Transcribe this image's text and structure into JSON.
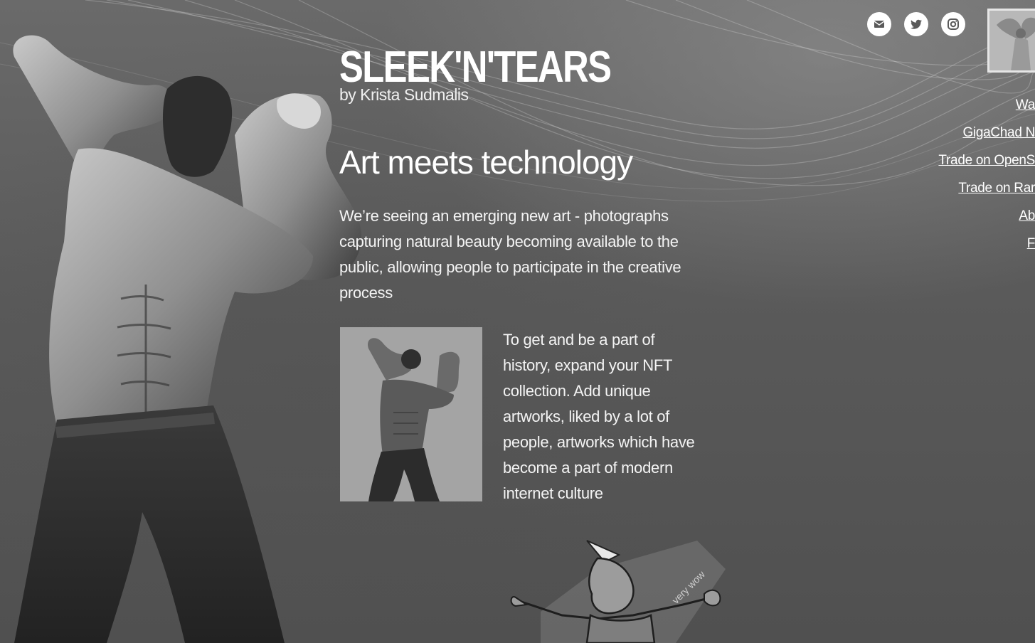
{
  "header": {
    "logo": "SLEEK'N'TEARS",
    "byline": "by Krista Sudmalis"
  },
  "main": {
    "headline": "Art meets technology",
    "intro": "We’re seeing an emerging new art - photographs capturing natural beauty becoming available to the public, allowing people to participate in the creative process",
    "feature_text": "To get and be a part of history, expand your NFT collection. Add unique artworks, liked by a lot of people, artworks which have become a part of modern internet culture",
    "meme_caption": "very wow"
  },
  "social": {
    "icons": [
      "mail-icon",
      "twitter-icon",
      "instagram-icon"
    ]
  },
  "nav": {
    "items": [
      {
        "label": "Wa"
      },
      {
        "label": "GigaChad N"
      },
      {
        "label": "Trade on OpenS"
      },
      {
        "label": "Trade on Rar"
      },
      {
        "label": "Ab"
      },
      {
        "label": "F"
      }
    ]
  },
  "colors": {
    "background": "#5e5e5e",
    "text": "#ffffff",
    "icon_bg": "#ffffff",
    "icon_fg": "#5a5a5a"
  }
}
